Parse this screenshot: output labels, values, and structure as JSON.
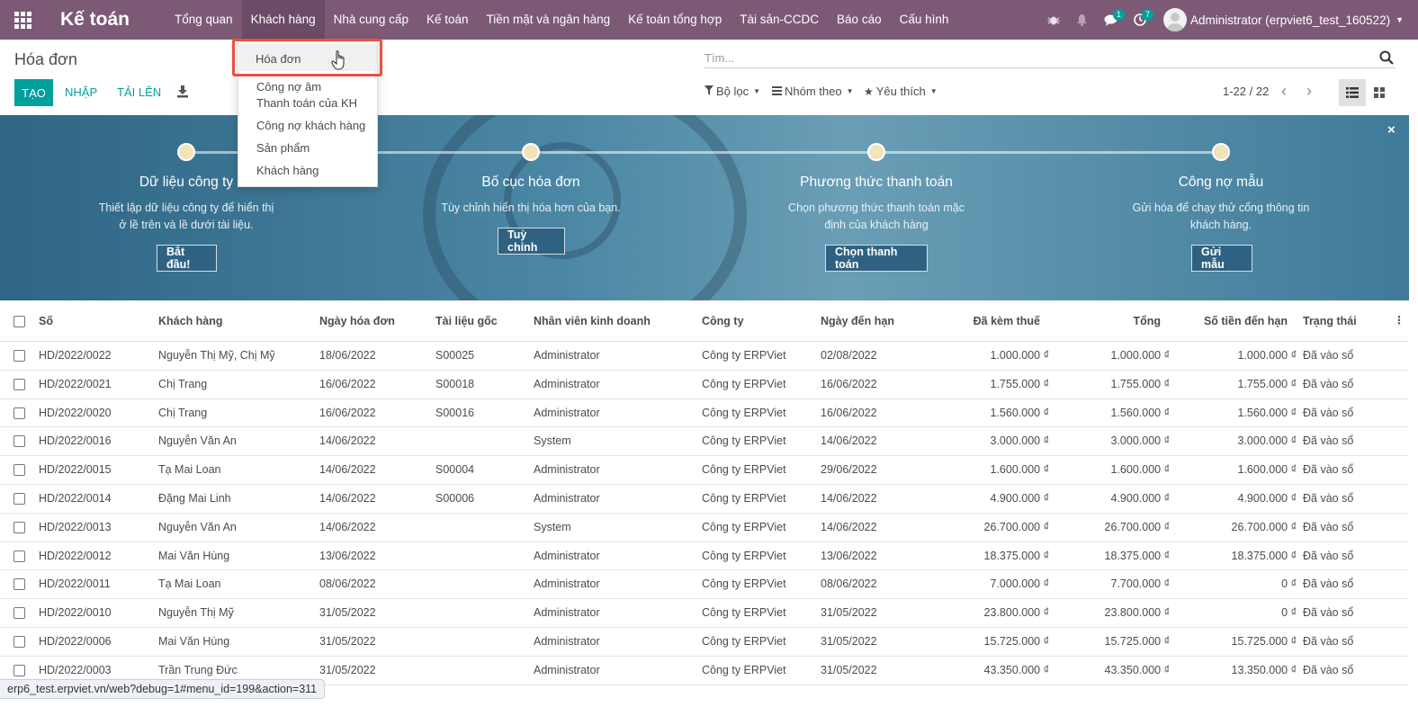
{
  "navbar": {
    "brand": "Kế toán",
    "menu": [
      "Tổng quan",
      "Khách hàng",
      "Nhà cung cấp",
      "Kế toán",
      "Tiền mặt và ngân hàng",
      "Kế toán tổng hợp",
      "Tài sản-CCDC",
      "Báo cáo",
      "Cấu hình"
    ],
    "active_menu": "Khách hàng",
    "messages_count": "1",
    "activities_count": "7",
    "user": "Administrator (erpviet6_test_160522)"
  },
  "control_panel": {
    "title": "Hóa đơn",
    "create_label": "TẠO",
    "import_label": "NHẬP",
    "upload_label": "TẢI LÊN",
    "search_placeholder": "Tìm...",
    "filter_label": "Bộ lọc",
    "group_label": "Nhóm theo",
    "favorite_label": "Yêu thích",
    "pager": "1-22 / 22"
  },
  "dropdown": {
    "items": [
      "Hóa đơn",
      "Công nợ âm",
      "Thanh toán của KH",
      "Công nợ khách hàng",
      "Sản phẩm",
      "Khách hàng"
    ],
    "highlighted": "Hóa đơn"
  },
  "banner": {
    "steps": [
      {
        "title": "Dữ liệu công ty",
        "desc1": "Thiết lập dữ liệu công ty để hiển thị",
        "desc2": "ở lề trên và lề dưới tài liệu.",
        "button": "Bắt đầu!"
      },
      {
        "title": "Bố cục hóa đơn",
        "desc1": "Tùy chỉnh hiển thị hóa hơn của bạn.",
        "desc2": "",
        "button": "Tuỳ chỉnh"
      },
      {
        "title": "Phương thức thanh toán",
        "desc1": "Chọn phương thức thanh toán mặc",
        "desc2": "định của khách hàng",
        "button": "Chọn thanh toán"
      },
      {
        "title": "Công nợ mẫu",
        "desc1": "Gửi hóa để chạy thử cổng thông tin",
        "desc2": "khách hàng.",
        "button": "Gửi mẫu"
      }
    ]
  },
  "table": {
    "headers": {
      "so": "Số",
      "khach_hang": "Khách hàng",
      "ngay_hd": "Ngày hóa đơn",
      "tai_lieu": "Tài liệu gốc",
      "nhan_vien": "Nhân viên kinh doanh",
      "cong_ty": "Công ty",
      "ngay_han": "Ngày đến hạn",
      "da_kem_thue": "Đã kèm thuế",
      "tong": "Tổng",
      "so_tien_han": "Số tiền đến hạn",
      "trang_thai": "Trạng thái"
    },
    "rows": [
      [
        "HD/2022/0022",
        "Nguyễn Thị Mỹ, Chị Mỹ",
        "18/06/2022",
        "S00025",
        "Administrator",
        "Công ty ERPViet",
        "02/08/2022",
        "1.000.000 ₫",
        "1.000.000 ₫",
        "1.000.000 ₫",
        "Đã vào sổ"
      ],
      [
        "HD/2022/0021",
        "Chị Trang",
        "16/06/2022",
        "S00018",
        "Administrator",
        "Công ty ERPViet",
        "16/06/2022",
        "1.755.000 ₫",
        "1.755.000 ₫",
        "1.755.000 ₫",
        "Đã vào sổ"
      ],
      [
        "HD/2022/0020",
        "Chị Trang",
        "16/06/2022",
        "S00016",
        "Administrator",
        "Công ty ERPViet",
        "16/06/2022",
        "1.560.000 ₫",
        "1.560.000 ₫",
        "1.560.000 ₫",
        "Đã vào sổ"
      ],
      [
        "HD/2022/0016",
        "Nguyễn Văn An",
        "14/06/2022",
        "",
        "System",
        "Công ty ERPViet",
        "14/06/2022",
        "3.000.000 ₫",
        "3.000.000 ₫",
        "3.000.000 ₫",
        "Đã vào sổ"
      ],
      [
        "HD/2022/0015",
        "Tạ Mai Loan",
        "14/06/2022",
        "S00004",
        "Administrator",
        "Công ty ERPViet",
        "29/06/2022",
        "1.600.000 ₫",
        "1.600.000 ₫",
        "1.600.000 ₫",
        "Đã vào sổ"
      ],
      [
        "HD/2022/0014",
        "Đặng Mai Linh",
        "14/06/2022",
        "S00006",
        "Administrator",
        "Công ty ERPViet",
        "14/06/2022",
        "4.900.000 ₫",
        "4.900.000 ₫",
        "4.900.000 ₫",
        "Đã vào sổ"
      ],
      [
        "HD/2022/0013",
        "Nguyễn Văn An",
        "14/06/2022",
        "",
        "System",
        "Công ty ERPViet",
        "14/06/2022",
        "26.700.000 ₫",
        "26.700.000 ₫",
        "26.700.000 ₫",
        "Đã vào sổ"
      ],
      [
        "HD/2022/0012",
        "Mai Văn Hùng",
        "13/06/2022",
        "",
        "Administrator",
        "Công ty ERPViet",
        "13/06/2022",
        "18.375.000 ₫",
        "18.375.000 ₫",
        "18.375.000 ₫",
        "Đã vào sổ"
      ],
      [
        "HD/2022/0011",
        "Tạ Mai Loan",
        "08/06/2022",
        "",
        "Administrator",
        "Công ty ERPViet",
        "08/06/2022",
        "7.000.000 ₫",
        "7.700.000 ₫",
        "0 ₫",
        "Đã vào sổ"
      ],
      [
        "HD/2022/0010",
        "Nguyễn Thị Mỹ",
        "31/05/2022",
        "",
        "Administrator",
        "Công ty ERPViet",
        "31/05/2022",
        "23.800.000 ₫",
        "23.800.000 ₫",
        "0 ₫",
        "Đã vào sổ"
      ],
      [
        "HD/2022/0006",
        "Mai Văn Hùng",
        "31/05/2022",
        "",
        "Administrator",
        "Công ty ERPViet",
        "31/05/2022",
        "15.725.000 ₫",
        "15.725.000 ₫",
        "15.725.000 ₫",
        "Đã vào sổ"
      ],
      [
        "HD/2022/0003",
        "Trần Trung Đức",
        "31/05/2022",
        "",
        "Administrator",
        "Công ty ERPViet",
        "31/05/2022",
        "43.350.000 ₫",
        "43.350.000 ₫",
        "13.350.000 ₫",
        "Đã vào sổ"
      ]
    ]
  },
  "statusbar": {
    "url": "erp6_test.erpviet.vn/web?debug=1#menu_id=199&action=311"
  },
  "colors": {
    "navbar": "#7c5a76",
    "primary": "#00a09d",
    "highlight": "#e8513f"
  }
}
